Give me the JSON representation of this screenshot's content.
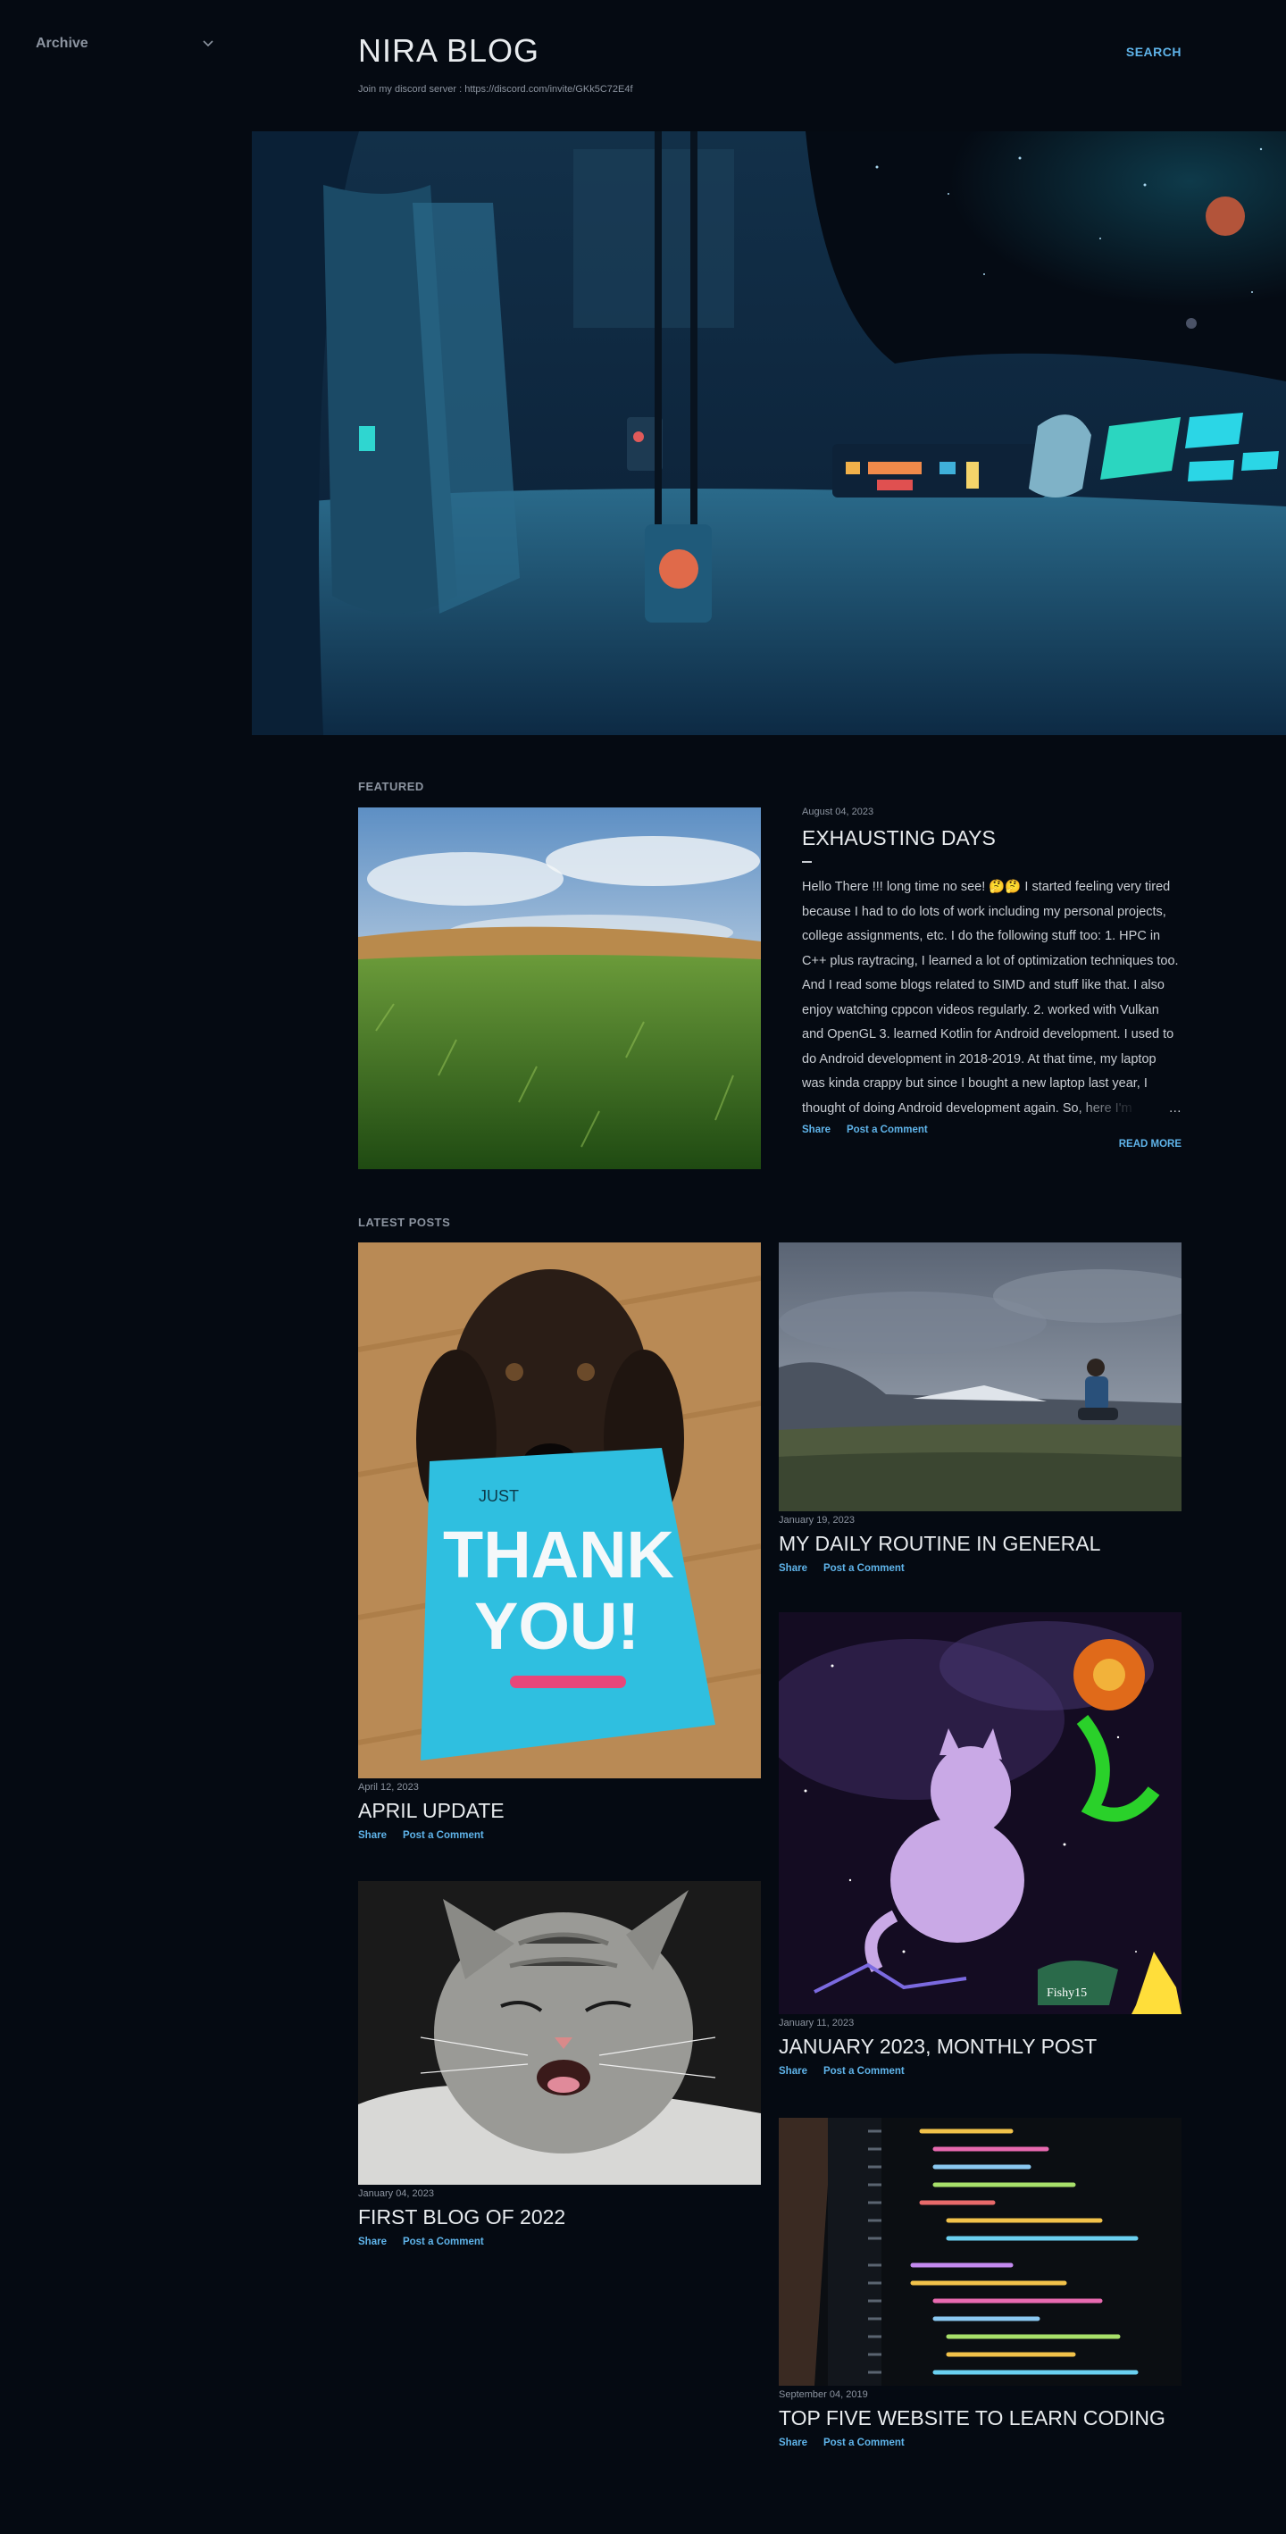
{
  "sidebar": {
    "archive_label": "Archive"
  },
  "header": {
    "title": "NIRA BLOG",
    "description": "Join my discord server : https://discord.com/invite/GKk5C72E4f",
    "search_label": "SEARCH"
  },
  "featured": {
    "section_label": "FEATURED",
    "date": "August 04, 2023",
    "title": "EXHAUSTING DAYS",
    "snippet": "Hello There !!! long time no see! 🤔🤔  I started feeling very tired because I had to do lots of work including my personal projects, college assignments, etc. I do the following stuff too: 1. HPC in C++ plus raytracing, I learned a lot of optimization techniques too. And I read some blogs related to SIMD and stuff like that. I also enjoy watching cppcon videos regularly. 2. worked with Vulkan and OpenGL 3. learned Kotlin for Android development. I used to do Android development in 2018-2019. At that time, my laptop was kinda crappy but since I bought a new laptop last year, I thought of doing Android development again. So, here I'm lolololol........ I don't write",
    "ellipsis": "…",
    "share": "Share",
    "comment": "Post a Comment",
    "read_more": "READ MORE"
  },
  "latest": {
    "section_label": "LATEST POSTS",
    "share": "Share",
    "comment": "Post a Comment",
    "posts": [
      {
        "date": "April 12, 2023",
        "title": "APRIL UPDATE"
      },
      {
        "date": "January 19, 2023",
        "title": "MY DAILY ROUTINE IN GENERAL"
      },
      {
        "date": "January 11, 2023",
        "title": "JANUARY 2023, MONTHLY POST"
      },
      {
        "date": "January 04, 2023",
        "title": "FIRST BLOG OF 2022"
      },
      {
        "date": "September 04, 2019",
        "title": "TOP FIVE WEBSITE TO LEARN CODING"
      }
    ]
  },
  "images": {
    "thankyou_card_line1": "JUST",
    "thankyou_card_line2": "THANK",
    "thankyou_card_line3": "YOU!",
    "art_signature": "Fishy15"
  },
  "colors": {
    "background": "#050a12",
    "accent": "#5fb4ea",
    "text": "#c9cdd3"
  }
}
